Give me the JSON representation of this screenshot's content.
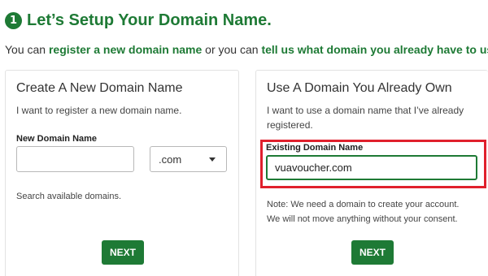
{
  "header": {
    "step_number": "1",
    "title": "Let’s Setup Your Domain Name.",
    "subtitle_part1": "You can ",
    "subtitle_link1": "register a new domain name",
    "subtitle_part2": " or you can ",
    "subtitle_link2": "tell us what domain you already have to use",
    "subtitle_part3": "."
  },
  "new_domain_card": {
    "title": "Create A New Domain Name",
    "description": "I want to register a new domain name.",
    "field_label": "New Domain Name",
    "domain_value": "",
    "tld_selected": ".com",
    "hint": "Search available domains.",
    "next_label": "NEXT"
  },
  "existing_domain_card": {
    "title": "Use A Domain You Already Own",
    "description": "I want to use a domain name that I’ve already registered.",
    "field_label": "Existing Domain Name",
    "domain_value": "vuavoucher.com",
    "note_line1": "Note: We need a domain to create your account.",
    "note_line2": "We will not move anything without your consent.",
    "next_label": "NEXT"
  },
  "colors": {
    "accent": "#1e7a35",
    "highlight": "#e0202c"
  }
}
